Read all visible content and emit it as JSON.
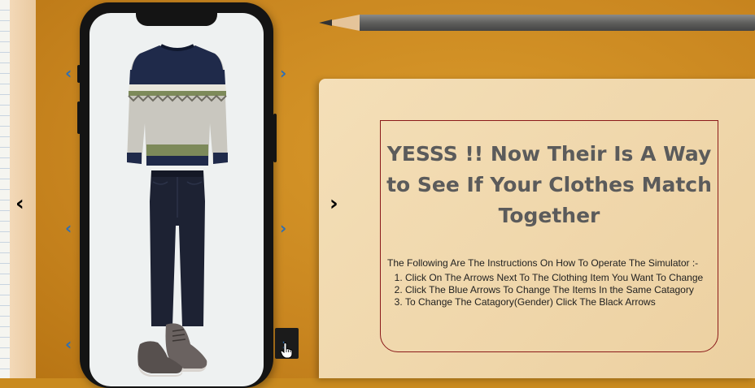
{
  "info": {
    "title": "YESSS !! Now Their Is A Way to See If Your Clothes Match Together",
    "intro": "The Following Are The Instructions On How To Operate The Simulator :-",
    "steps": [
      "Click On The Arrows Next To The Clothing Item You Want To Change",
      "Click The Blue Arrows To Change The Items In the Same Catagory",
      "To Change The Catagory(Gender) Click The Black Arrows"
    ]
  },
  "arrows": {
    "blue_prev": "‹",
    "blue_next": "›",
    "black_prev": "‹",
    "black_next": "›"
  },
  "outfit": {
    "top": "sweater-image",
    "bottom": "jeans-image",
    "shoes": "shoes-image"
  },
  "colors": {
    "title": "#5b5b5b",
    "border": "#8b1a1a",
    "blue_arrow": "#2e6fb4",
    "desk": "#c98a1f"
  }
}
